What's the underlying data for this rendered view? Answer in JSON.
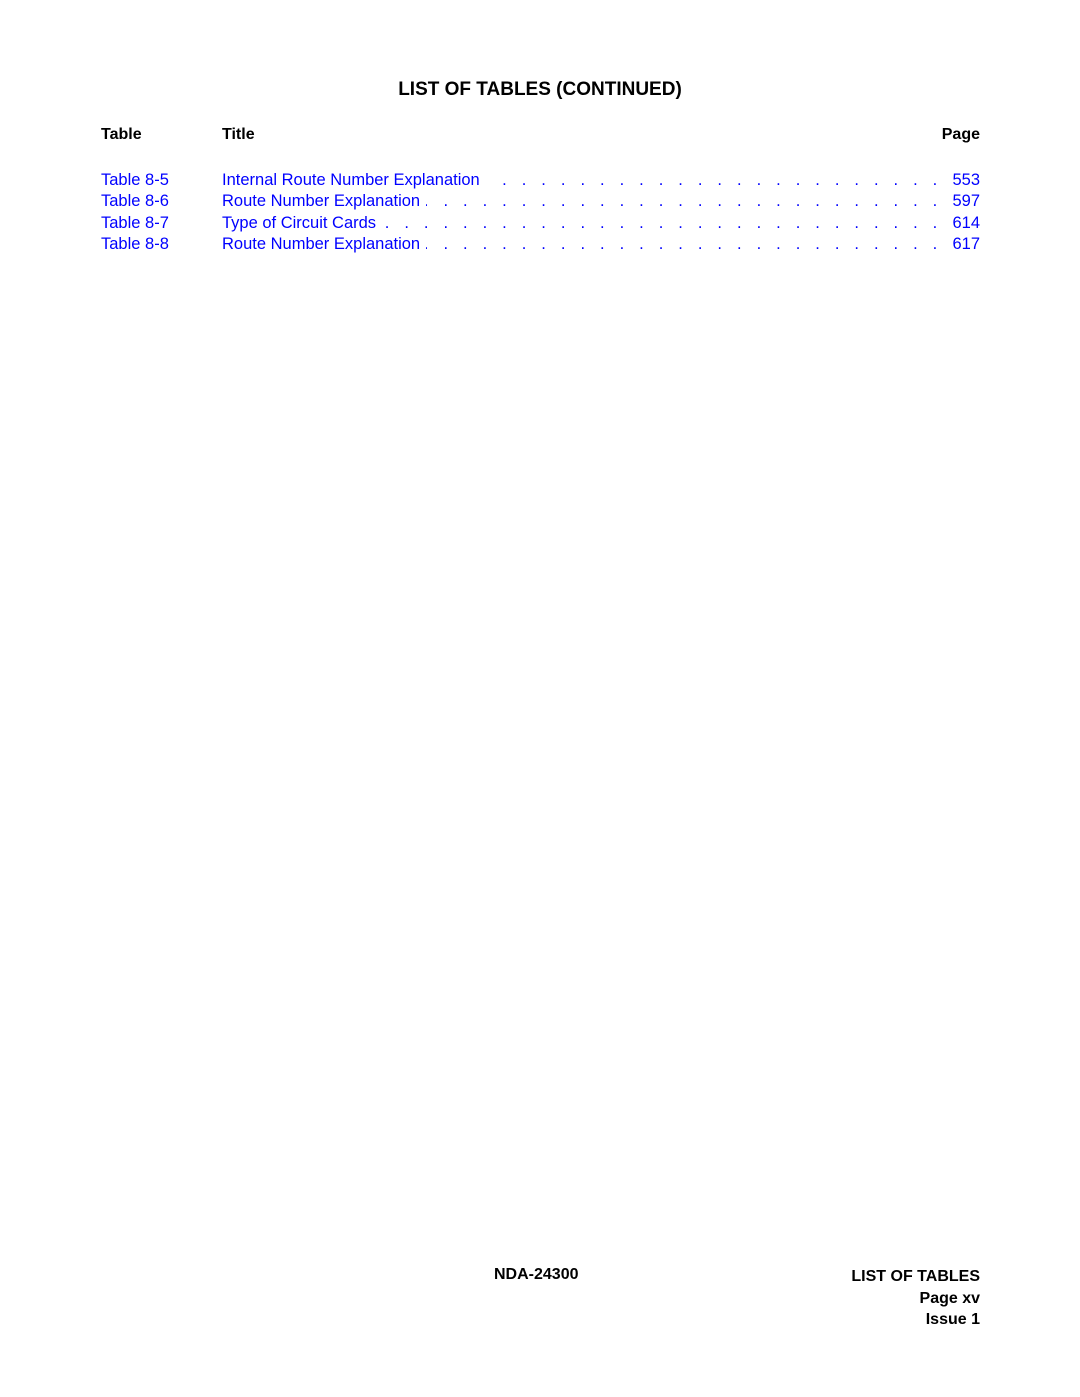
{
  "heading": "LIST OF TABLES (CONTINUED)",
  "columns": {
    "table": "Table",
    "title": "Title",
    "page": "Page"
  },
  "entries": [
    {
      "label": "Table 8-5",
      "title": "Internal Route Number Explanation",
      "page": "553"
    },
    {
      "label": "Table 8-6",
      "title": "Route Number Explanation",
      "page": "597"
    },
    {
      "label": "Table 8-7",
      "title": "Type of Circuit Cards",
      "page": "614"
    },
    {
      "label": "Table 8-8",
      "title": "Route Number Explanation",
      "page": "617"
    }
  ],
  "leader_dots": ". . . . . . . . . . . . . . . . . . . . . . . . . . . . . . . . . . . . . . . . . . . . . . . . . . . . . . . . . . . . . . . . . . . .",
  "footer": {
    "doc_number": "NDA-24300",
    "section": "LIST OF TABLES",
    "page": "Page xv",
    "issue": "Issue 1"
  },
  "colors": {
    "link": "#0000ff",
    "text": "#000000"
  }
}
